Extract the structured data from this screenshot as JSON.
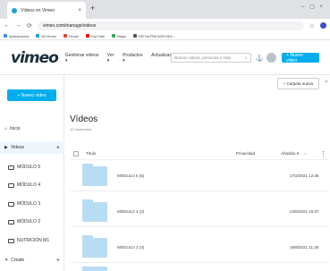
{
  "browser": {
    "tab_title": "Vídeos en Vimeo",
    "tab_close": "×",
    "new_tab": "+",
    "window_controls": "– ▢ ×",
    "back": "←",
    "forward": "→",
    "reload": "⟳",
    "home": "⌂",
    "url": "vimeo.com/manage/videos",
    "star": "☆",
    "bookmarks": [
      {
        "label": "Aplicaciones",
        "color": "#4285f4"
      },
      {
        "label": "Mi Vimeo",
        "color": "#1a9fd8"
      },
      {
        "label": "Gmail",
        "color": "#ea4335"
      },
      {
        "label": "YouTube",
        "color": "#ff0000"
      },
      {
        "label": "Maps",
        "color": "#34a853"
      },
      {
        "label": "DR NUTRICION DEL...",
        "color": "#555555"
      }
    ]
  },
  "vimeo": {
    "logo": "vimeo",
    "nav": [
      "Gestionar videos ▾",
      "Ver ▾",
      "Productos ▾",
      "Actualizar"
    ],
    "search_placeholder": "Buscar vídeos, personas y más",
    "search_icon": "⌕",
    "bell_icon": "🔔",
    "new_video_top": "+ Nuevo video",
    "accent": "#00adef"
  },
  "sidebar": {
    "new_button": "+ Nuevo video",
    "items": [
      {
        "label": "Inicio",
        "icon": "home-icon",
        "glyph": "⌂"
      },
      {
        "label": "Videos",
        "icon": "videos-icon",
        "glyph": "▶",
        "plus": "+"
      },
      {
        "label": "MÓDULO 5",
        "icon": "folder-icon"
      },
      {
        "label": "MÓDULO 4",
        "icon": "folder-icon"
      },
      {
        "label": "MÓDULO 3",
        "icon": "folder-icon"
      },
      {
        "label": "MÓDULO 2",
        "icon": "folder-icon"
      },
      {
        "label": "NUTRICIÓN M1",
        "icon": "folder-icon"
      },
      {
        "label": "Create",
        "icon": "create-icon",
        "glyph": "✦",
        "plus": "+"
      }
    ]
  },
  "main": {
    "create_folder": "+ Carpeta nueva",
    "search_icon": "⌕",
    "title": "Vídeos",
    "count": "12 elementos",
    "columns": {
      "title": "Título",
      "privacy": "Privacidad",
      "date": "Añadido ▾",
      "arrow": "↓",
      "menu": "⋮"
    },
    "rows": [
      {
        "name": "MÓDULO 5 (5)",
        "date": "17/2/2021 12:36"
      },
      {
        "name": "MÓDULO 4 (3)",
        "date": "23/8/2021 16:37"
      },
      {
        "name": "MÓDULO 3 (3)",
        "date": "18/8/2021 11:25"
      }
    ]
  }
}
